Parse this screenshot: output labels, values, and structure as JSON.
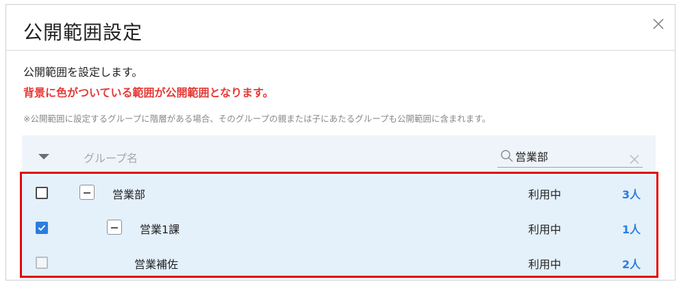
{
  "dialog": {
    "title": "公開範囲設定",
    "description": "公開範囲を設定します。",
    "warning": "背景に色がついている範囲が公開範囲となります。",
    "note": "※公開範囲に設定するグループに階層がある場合、そのグループの親または子にあたるグループも公開範囲に含まれます。"
  },
  "table": {
    "header": {
      "name_label": "グループ名",
      "search_value": "営業部"
    },
    "rows": [
      {
        "name": "営業部",
        "status": "利用中",
        "count": "3人",
        "checked": false,
        "expandable": true,
        "level": 0
      },
      {
        "name": "営業1課",
        "status": "利用中",
        "count": "1人",
        "checked": true,
        "expandable": true,
        "level": 1
      },
      {
        "name": "営業補佐",
        "status": "利用中",
        "count": "2人",
        "checked": false,
        "disabled": true,
        "expandable": false,
        "level": 2
      }
    ]
  },
  "colors": {
    "accent": "#2b7de1",
    "warning": "#e53935",
    "highlight_border": "#e00000",
    "row_background": "#e4f0fa"
  }
}
